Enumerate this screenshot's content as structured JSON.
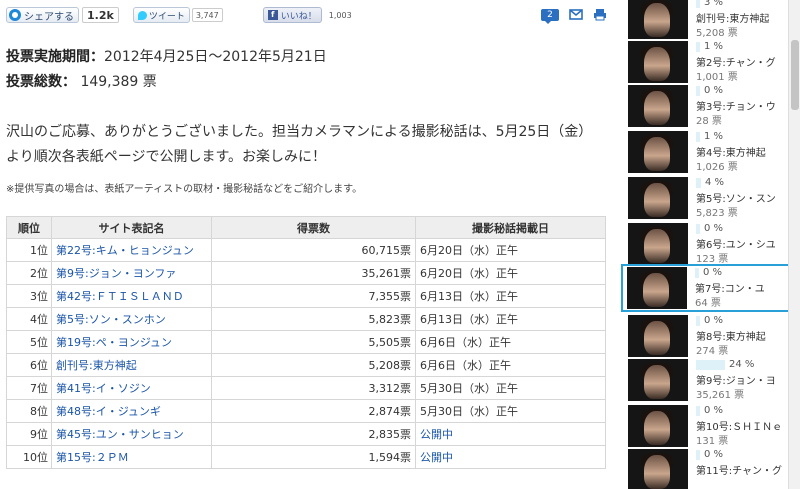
{
  "share": {
    "share_label": "シェアする",
    "share_count": "1.2k",
    "tweet_label": "ツイート",
    "tweet_count": "3,747",
    "like_label": "いいね！",
    "like_count": "1,003",
    "comment_count": "2"
  },
  "article": {
    "period_label": "投票実施期間：",
    "period_value": "2012年4月25日～2012年5月21日",
    "total_label": "投票総数：",
    "total_value": " 149,389 票",
    "thanks_text": "沢山のご応募、ありがとうございました。担当カメラマンによる撮影秘話は、5月25日（金）より順次各表紙ページで公開します。お楽しみに！",
    "note": "※提供写真の場合は、表紙アーティストの取材・撮影秘話などをご紹介します。"
  },
  "table": {
    "headers": [
      "順位",
      "サイト表記名",
      "得票数",
      "撮影秘話掲載日"
    ],
    "rows": [
      {
        "rank": "1位",
        "title": "第22号:キム・ヒョンジュン",
        "votes": "60,715票",
        "date": "6月20日（水）正午"
      },
      {
        "rank": "2位",
        "title": "第9号:ジョン・ヨンファ",
        "votes": "35,261票",
        "date": "6月20日（水）正午"
      },
      {
        "rank": "3位",
        "title": "第42号:ＦＴＩＳＬＡＮＤ",
        "votes": "7,355票",
        "date": "6月13日（水）正午"
      },
      {
        "rank": "4位",
        "title": "第5号:ソン・スンホン",
        "votes": "5,823票",
        "date": "6月13日（水）正午"
      },
      {
        "rank": "5位",
        "title": "第19号:ペ・ヨンジュン",
        "votes": "5,505票",
        "date": "6月6日（水）正午"
      },
      {
        "rank": "6位",
        "title": "創刊号:東方神起",
        "votes": "5,208票",
        "date": "6月6日（水）正午"
      },
      {
        "rank": "7位",
        "title": "第41号:イ・ソジン",
        "votes": "3,312票",
        "date": "5月30日（水）正午"
      },
      {
        "rank": "8位",
        "title": "第48号:イ・ジュンギ",
        "votes": "2,874票",
        "date": "5月30日（水）正午"
      },
      {
        "rank": "9位",
        "title": "第45号:ユン・サンヒョン",
        "votes": "2,835票",
        "date": "公開中"
      },
      {
        "rank": "10位",
        "title": "第15号:２ＰＭ",
        "votes": "1,594票",
        "date": "公開中"
      }
    ]
  },
  "sidebar": {
    "items": [
      {
        "pct": "3 %",
        "title": "創刊号:東方神起",
        "votes": "5,208 票",
        "pct_value": 3
      },
      {
        "pct": "1 %",
        "title": "第2号:チャン・グ",
        "votes": "1,001 票",
        "pct_value": 1
      },
      {
        "pct": "0 %",
        "title": "第3号:チョン・ウ",
        "votes": "28 票",
        "pct_value": 0
      },
      {
        "pct": "1 %",
        "title": "第4号:東方神起",
        "votes": "1,026 票",
        "pct_value": 1
      },
      {
        "pct": "4 %",
        "title": "第5号:ソン・スン",
        "votes": "5,823 票",
        "pct_value": 4
      },
      {
        "pct": "0 %",
        "title": "第6号:ユン・シユ",
        "votes": "123 票",
        "pct_value": 0
      },
      {
        "pct": "0 %",
        "title": "第7号:コン・ユ",
        "votes": "64 票",
        "pct_value": 0
      },
      {
        "pct": "0 %",
        "title": "第8号:東方神起",
        "votes": "274 票",
        "pct_value": 0
      },
      {
        "pct": "24 %",
        "title": "第9号:ジョン・ヨ",
        "votes": "35,261 票",
        "pct_value": 24
      },
      {
        "pct": "0 %",
        "title": "第10号:ＳＨＩＮｅ",
        "votes": "131 票",
        "pct_value": 0
      },
      {
        "pct": "0 %",
        "title": "第11号:チャン・グ",
        "votes": "",
        "pct_value": 0
      }
    ]
  }
}
